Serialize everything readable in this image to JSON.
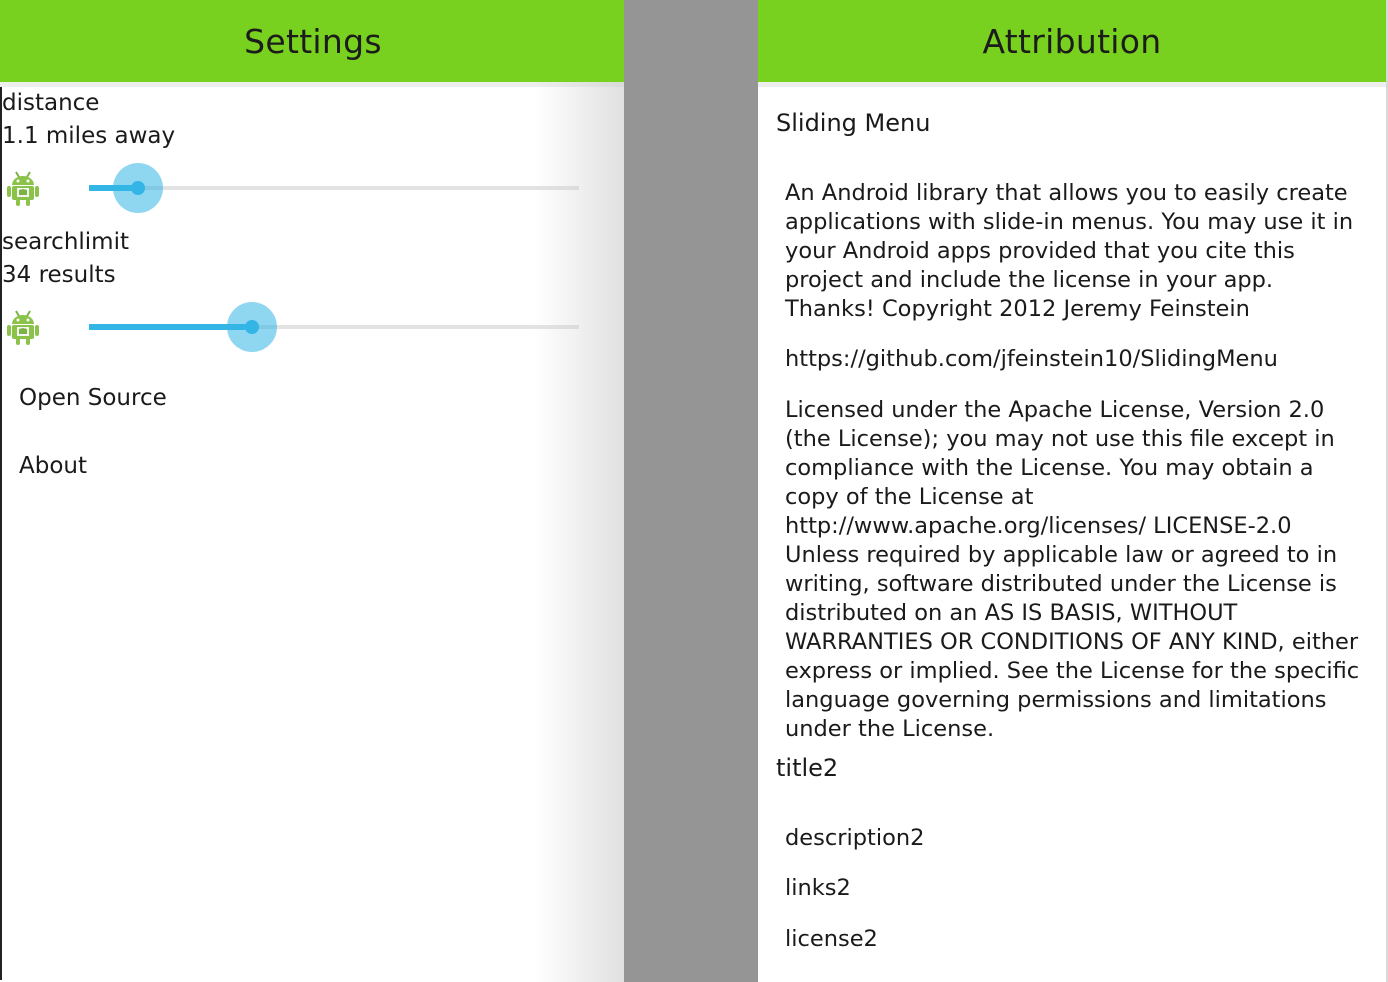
{
  "settings": {
    "title": "Settings",
    "distance": {
      "title": "distance",
      "value_text": "1.1 miles away",
      "slider_fraction": 0.1
    },
    "searchlimit": {
      "title": "searchlimit",
      "value_text": "34 results",
      "slider_fraction": 0.333
    },
    "menu": [
      "Open Source",
      "About"
    ]
  },
  "attribution": {
    "title": "Attribution",
    "libraries": [
      {
        "title": "Sliding Menu",
        "description": "An Android library that allows you to easily create applications with slide-in menus. You may use it in your Android apps provided that you cite this project and include the license in your app. Thanks! Copyright 2012 Jeremy Feinstein",
        "link": "https://github.com/jfeinstein10/SlidingMenu",
        "license": "Licensed under the Apache License, Version 2.0 (the License); you may not use this file except in compliance with the License. You may obtain a copy of the License at http://www.apache.org/licenses/ LICENSE-2.0 Unless required by applicable law or agreed to in writing, software distributed under the License is distributed on an AS IS BASIS, WITHOUT WARRANTIES OR CONDITIONS OF ANY KIND, either express or implied. See the License for the specific language governing permissions and limitations under the License."
      },
      {
        "title": "title2",
        "description": "description2",
        "link": "links2",
        "license": "license2"
      }
    ]
  },
  "colors": {
    "action_bar": "#78d01f",
    "slider_accent": "#33b5e5",
    "gutter": "#959595"
  },
  "icons": {
    "row_icon": "android-robot-icon"
  }
}
